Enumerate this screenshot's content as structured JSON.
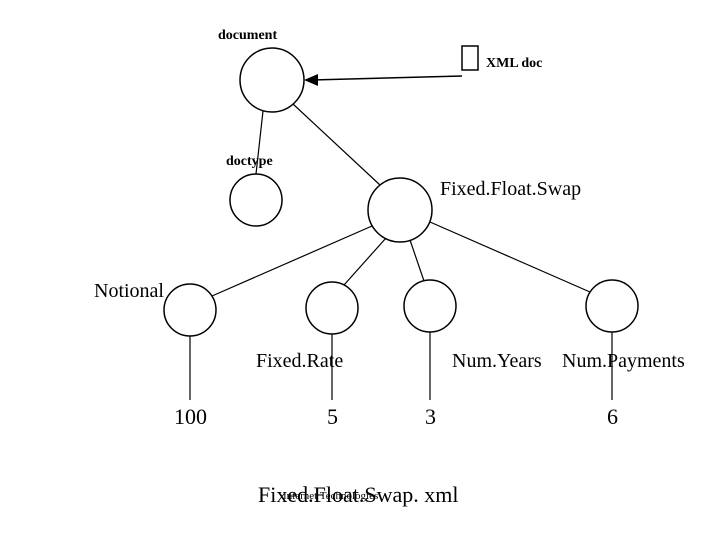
{
  "labels": {
    "document": "document",
    "xml_doc": "XML doc",
    "doctype": "doctype",
    "root_type": "Fixed.Float.Swap",
    "notional": "Notional",
    "fixed_rate": "Fixed.Rate",
    "num_years": "Num.Years",
    "num_payments": "Num.Payments",
    "filename": "Fixed.Float.Swap. xml",
    "footer_small": "Internet Technologies"
  },
  "values": {
    "notional": "100",
    "fixed_rate": "5",
    "num_years": "3",
    "num_payments": "6"
  },
  "chart_data": {
    "type": "diagram",
    "title": "Fixed.Float.Swap. xml",
    "description": "DOM / parse tree for an XML document",
    "nodes": [
      {
        "id": "xmlbox",
        "label": "XML doc",
        "points_to": "document"
      },
      {
        "id": "document",
        "label": "document",
        "children": [
          "doctype",
          "FixedFloatSwap"
        ]
      },
      {
        "id": "doctype",
        "label": "doctype",
        "children": []
      },
      {
        "id": "FixedFloatSwap",
        "label": "Fixed.Float.Swap",
        "children": [
          "Notional",
          "FixedRate",
          "NumYears",
          "NumPayments"
        ]
      },
      {
        "id": "Notional",
        "label": "Notional",
        "value": "100"
      },
      {
        "id": "FixedRate",
        "label": "Fixed.Rate",
        "value": "5"
      },
      {
        "id": "NumYears",
        "label": "Num.Years",
        "value": "3"
      },
      {
        "id": "NumPayments",
        "label": "Num.Payments",
        "value": "6"
      }
    ]
  }
}
